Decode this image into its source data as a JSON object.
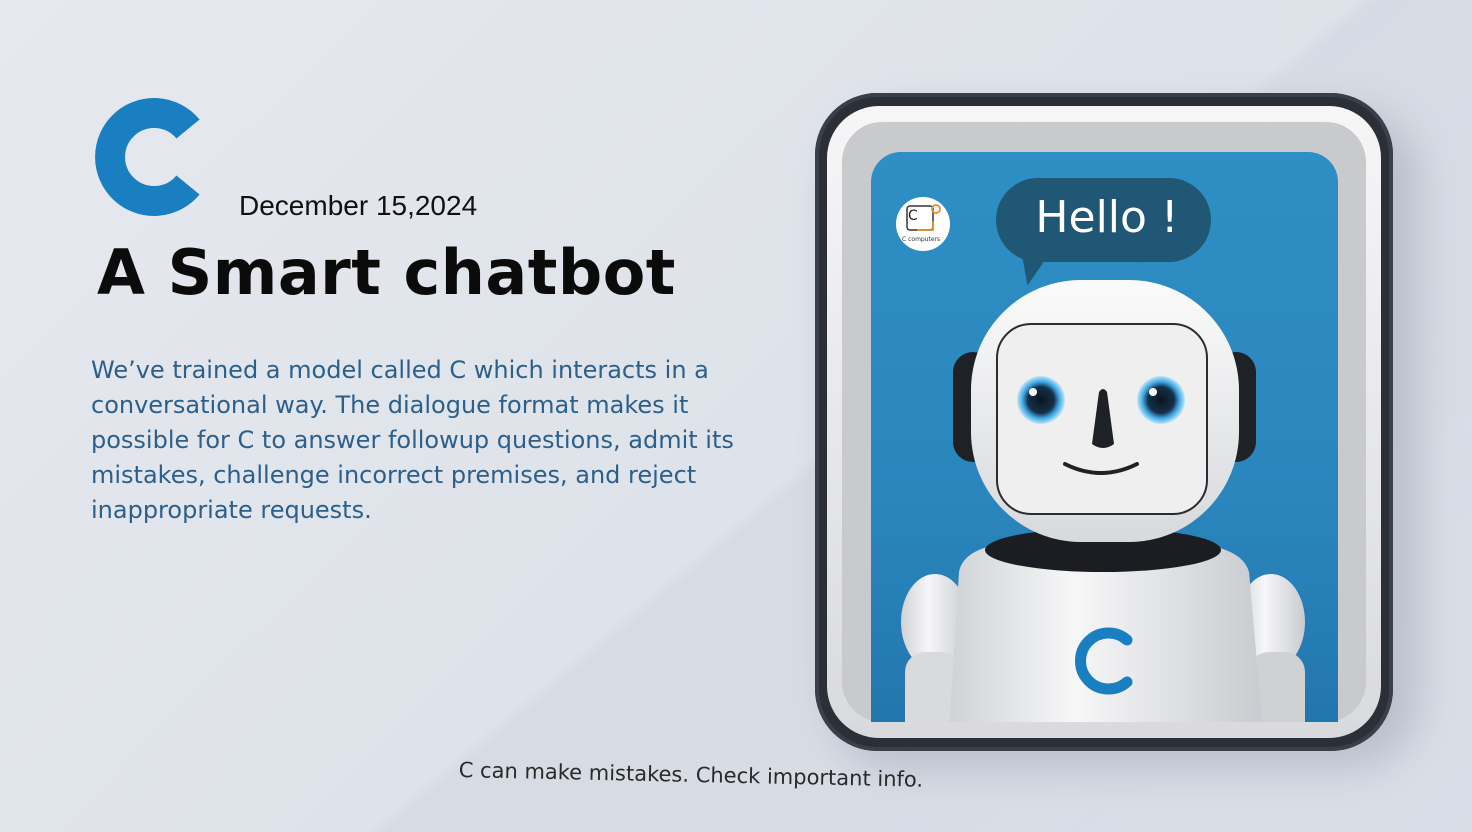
{
  "header": {
    "brand_letter": "C",
    "date": "December 15,2024",
    "title": "A Smart chatbot"
  },
  "description": {
    "lines": [
      "We’ve trained a model called C which interacts in a",
      "conversational way. The dialogue format makes it",
      "possible for C to answer followup questions, admit its",
      "mistakes, challenge incorrect premises, and reject",
      "inappropriate requests."
    ]
  },
  "illustration": {
    "speech_bubble": "Hello !",
    "mini_logo_letter": "C",
    "mini_logo_text": "C computers",
    "robot_chest_letter": "C"
  },
  "footer": {
    "disclaimer": "C can make mistakes. Check important info."
  },
  "colors": {
    "brand_blue": "#1a7fc1",
    "description_text": "#2c5f8a",
    "screen_blue": "#2e8fc4",
    "bubble": "#1f5775"
  }
}
